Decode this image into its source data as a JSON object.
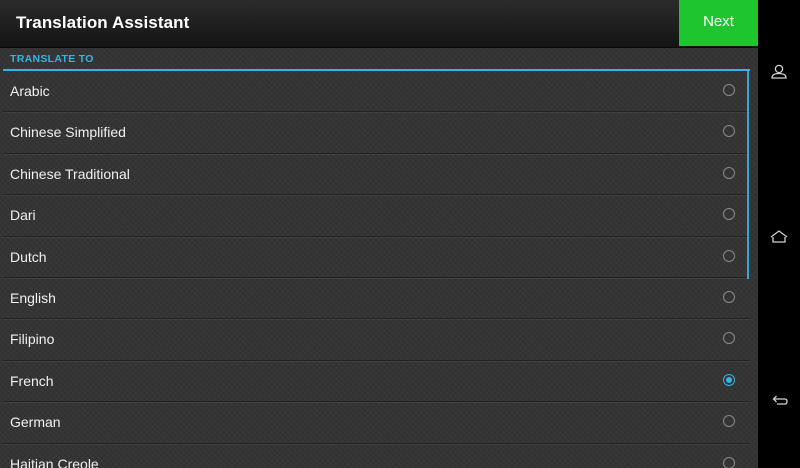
{
  "app": {
    "title": "Translation Assistant",
    "next_label": "Next"
  },
  "section": {
    "header": "TRANSLATE TO"
  },
  "languages": [
    {
      "label": "Arabic",
      "selected": false
    },
    {
      "label": "Chinese Simplified",
      "selected": false
    },
    {
      "label": "Chinese Traditional",
      "selected": false
    },
    {
      "label": "Dari",
      "selected": false
    },
    {
      "label": "Dutch",
      "selected": false
    },
    {
      "label": "English",
      "selected": false
    },
    {
      "label": "Filipino",
      "selected": false
    },
    {
      "label": "French",
      "selected": true
    },
    {
      "label": "German",
      "selected": false
    },
    {
      "label": "Haitian Creole",
      "selected": false
    }
  ],
  "colors": {
    "accent": "#33b5e5",
    "next_button": "#1fc52f",
    "background": "#333333"
  },
  "nav_icons": [
    "person-icon",
    "home-icon",
    "back-icon"
  ]
}
